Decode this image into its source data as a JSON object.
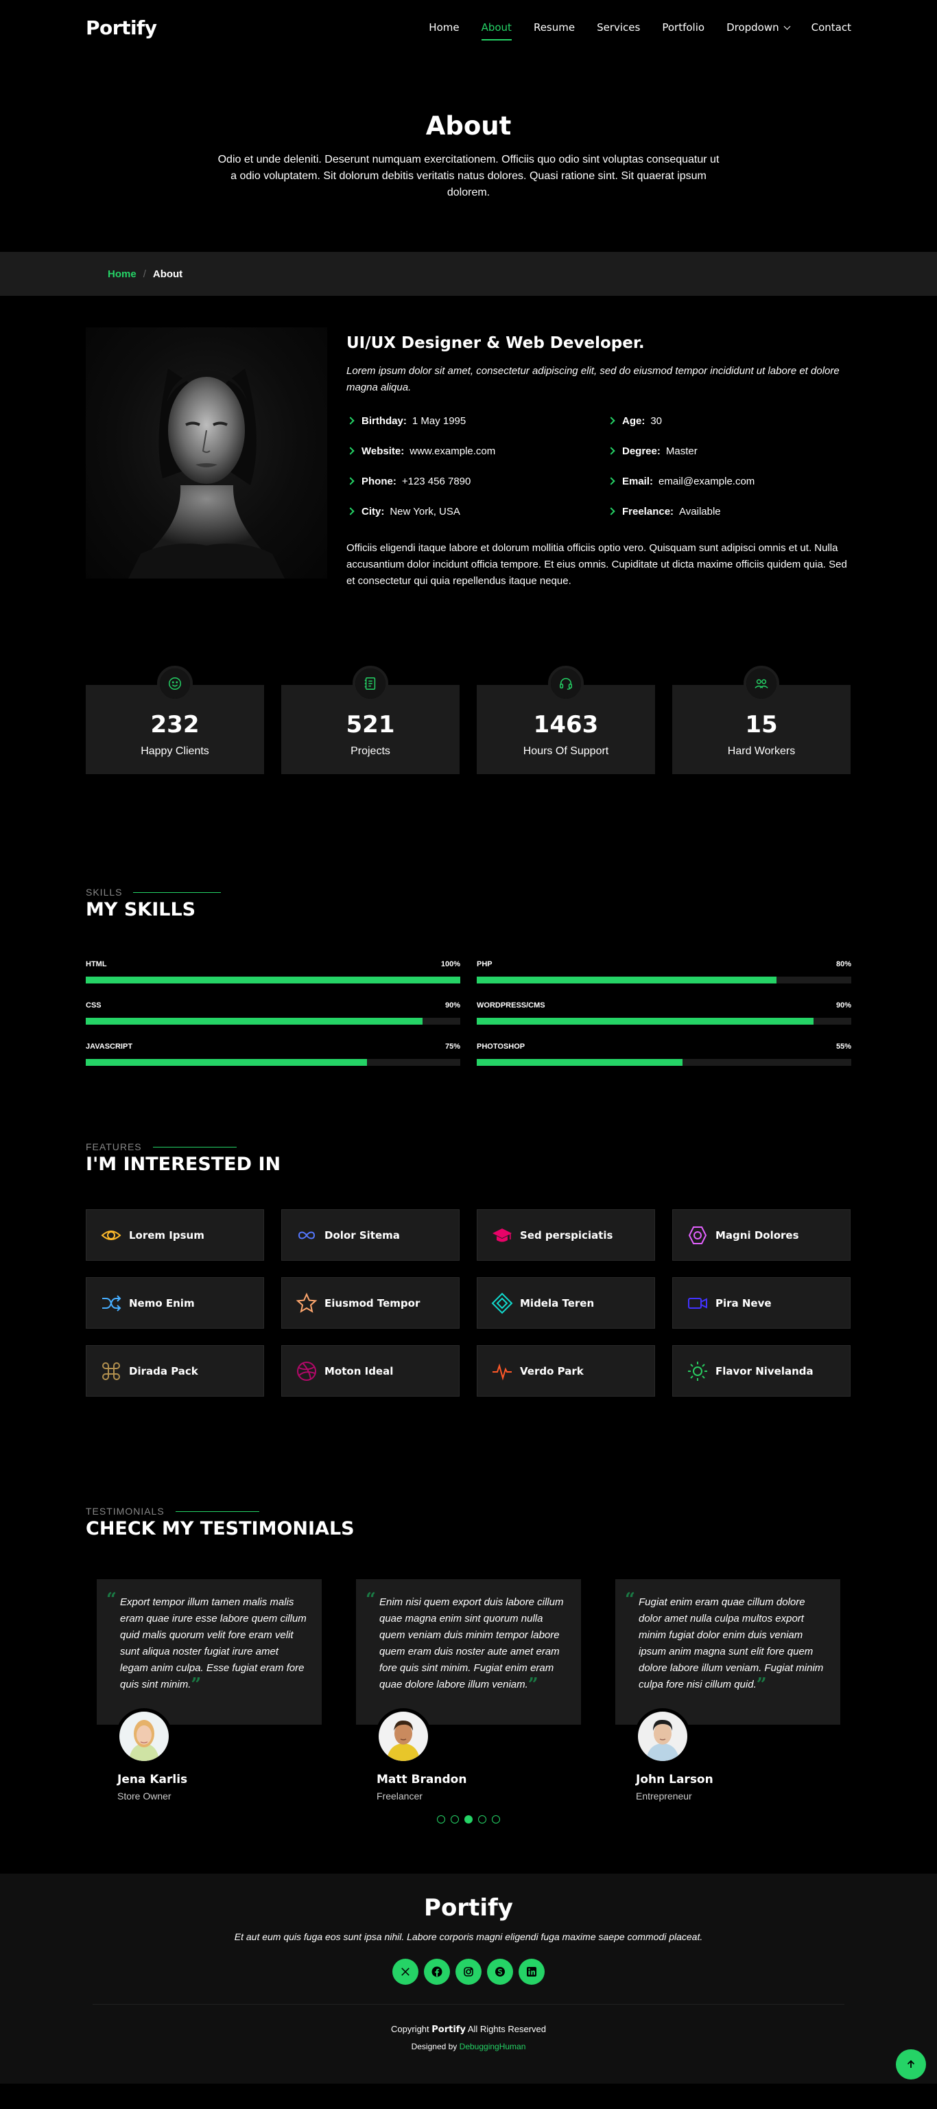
{
  "header": {
    "logo": "Portify",
    "nav": [
      {
        "label": "Home",
        "active": false
      },
      {
        "label": "About",
        "active": true
      },
      {
        "label": "Resume",
        "active": false
      },
      {
        "label": "Services",
        "active": false
      },
      {
        "label": "Portfolio",
        "active": false
      },
      {
        "label": "Dropdown",
        "active": false
      },
      {
        "label": "Contact",
        "active": false
      }
    ]
  },
  "page_title": {
    "title": "About",
    "text": "Odio et unde deleniti. Deserunt numquam exercitationem. Officiis quo odio sint voluptas consequatur ut a odio voluptatem. Sit dolorum debitis veritatis natus dolores. Quasi ratione sint. Sit quaerat ipsum dolorem."
  },
  "breadcrumb": {
    "home": "Home",
    "sep": "/",
    "current": "About"
  },
  "about": {
    "heading": "UI/UX Designer & Web Developer.",
    "lead": "Lorem ipsum dolor sit amet, consectetur adipiscing elit, sed do eiusmod tempor incididunt ut labore et dolore magna aliqua.",
    "info": [
      {
        "k": "Birthday:",
        "v": "1 May 1995"
      },
      {
        "k": "Age:",
        "v": "30"
      },
      {
        "k": "Website:",
        "v": "www.example.com"
      },
      {
        "k": "Degree:",
        "v": "Master"
      },
      {
        "k": "Phone:",
        "v": "+123 456 7890"
      },
      {
        "k": "Email:",
        "v": "email@example.com"
      },
      {
        "k": "City:",
        "v": "New York, USA"
      },
      {
        "k": "Freelance:",
        "v": "Available"
      }
    ],
    "desc": "Officiis eligendi itaque labore et dolorum mollitia officiis optio vero. Quisquam sunt adipisci omnis et ut. Nulla accusantium dolor incidunt officia tempore. Et eius omnis. Cupiditate ut dicta maxime officiis quidem quia. Sed et consectetur qui quia repellendus itaque neque."
  },
  "stats": [
    {
      "num": "232",
      "label": "Happy Clients",
      "icon": "smiley-icon"
    },
    {
      "num": "521",
      "label": "Projects",
      "icon": "journal-icon"
    },
    {
      "num": "1463",
      "label": "Hours Of Support",
      "icon": "headset-icon"
    },
    {
      "num": "15",
      "label": "Hard Workers",
      "icon": "people-icon"
    }
  ],
  "skills": {
    "small": "SKILLS",
    "title": "MY SKILLS",
    "items": [
      {
        "name": "HTML",
        "pct_label": "100%",
        "pct": 100
      },
      {
        "name": "PHP",
        "pct_label": "80%",
        "pct": 80
      },
      {
        "name": "CSS",
        "pct_label": "90%",
        "pct": 90
      },
      {
        "name": "WORDPRESS/CMS",
        "pct_label": "90%",
        "pct": 90
      },
      {
        "name": "JAVASCRIPT",
        "pct_label": "75%",
        "pct": 75
      },
      {
        "name": "PHOTOSHOP",
        "pct_label": "55%",
        "pct": 55
      }
    ]
  },
  "interests": {
    "small": "FEATURES",
    "title": "I'M INTERESTED IN",
    "items": [
      {
        "label": "Lorem Ipsum",
        "icon": "eye-icon",
        "color": "#ffbb2c"
      },
      {
        "label": "Dolor Sitema",
        "icon": "infinity-icon",
        "color": "#5578ff"
      },
      {
        "label": "Sed perspiciatis",
        "icon": "mortarboard-icon",
        "color": "#e80368"
      },
      {
        "label": "Magni Dolores",
        "icon": "nut-icon",
        "color": "#e361ff"
      },
      {
        "label": "Nemo Enim",
        "icon": "shuffle-icon",
        "color": "#47aeff"
      },
      {
        "label": "Eiusmod Tempor",
        "icon": "star-icon",
        "color": "#ffa76e"
      },
      {
        "label": "Midela Teren",
        "icon": "diamond-icon",
        "color": "#11dbcf"
      },
      {
        "label": "Pira Neve",
        "icon": "camera-video-icon",
        "color": "#4233ff"
      },
      {
        "label": "Dirada Pack",
        "icon": "command-icon",
        "color": "#b2904f"
      },
      {
        "label": "Moton Ideal",
        "icon": "dribbble-icon",
        "color": "#b20969"
      },
      {
        "label": "Verdo Park",
        "icon": "activity-icon",
        "color": "#ff5828"
      },
      {
        "label": "Flavor Nivelanda",
        "icon": "sun-icon",
        "color": "#29cc61"
      }
    ]
  },
  "testimonials": {
    "small": "TESTIMONIALS",
    "title": "CHECK MY TESTIMONIALS",
    "items": [
      {
        "text": "Export tempor illum tamen malis malis eram quae irure esse labore quem cillum quid malis quorum velit fore eram velit sunt aliqua noster fugiat irure amet legam anim culpa. Esse fugiat eram fore quis sint minim.",
        "name": "Jena Karlis",
        "role": "Store Owner"
      },
      {
        "text": "Enim nisi quem export duis labore cillum quae magna enim sint quorum nulla quem veniam duis minim tempor labore quem eram duis noster aute amet eram fore quis sint minim. Fugiat enim eram quae dolore labore illum veniam.",
        "name": "Matt Brandon",
        "role": "Freelancer"
      },
      {
        "text": "Fugiat enim eram quae cillum dolore dolor amet nulla culpa multos export minim fugiat dolor enim duis veniam ipsum anim magna sunt elit fore quem dolore labore illum veniam. Fugiat minim culpa fore nisi cillum quid.",
        "name": "John Larson",
        "role": "Entrepreneur"
      }
    ],
    "dots": 5,
    "active_dot": 3
  },
  "footer": {
    "logo": "Portify",
    "text": "Et aut eum quis fuga eos sunt ipsa nihil. Labore corporis magni eligendi fuga maxime saepe commodi placeat.",
    "socials": [
      "x-icon",
      "facebook-icon",
      "instagram-icon",
      "skype-icon",
      "linkedin-icon"
    ],
    "copyright_prefix": "Copyright",
    "copyright_brand": "Portify",
    "copyright_suffix": "All Rights Reserved",
    "designed_prefix": "Designed by",
    "designed_link": "DebuggingHuman"
  },
  "colors": {
    "accent": "#25d366",
    "bg": "#000000",
    "card": "#1c1c1c"
  }
}
